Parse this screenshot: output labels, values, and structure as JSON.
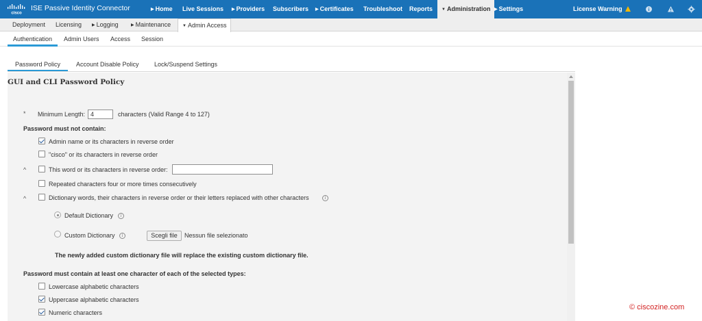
{
  "app": {
    "title": "ISE Passive Identity Connector",
    "logo_text": "cisco"
  },
  "top_nav": {
    "home": "Home",
    "live_sessions": "Live Sessions",
    "providers": "Providers",
    "subscribers": "Subscribers",
    "certificates": "Certificates",
    "troubleshoot": "Troubleshoot",
    "reports": "Reports",
    "administration": "Administration",
    "settings": "Settings",
    "license_warning": "License Warning"
  },
  "sub_nav": {
    "deployment": "Deployment",
    "licensing": "Licensing",
    "logging": "Logging",
    "maintenance": "Maintenance",
    "admin_access": "Admin Access"
  },
  "third_nav": {
    "authentication": "Authentication",
    "admin_users": "Admin Users",
    "access": "Access",
    "session": "Session"
  },
  "tabs": {
    "password_policy": "Password Policy",
    "account_disable_policy": "Account Disable Policy",
    "lock_suspend_settings": "Lock/Suspend Settings"
  },
  "policy": {
    "title": "GUI and CLI Password Policy",
    "required_mark": "*",
    "caret_mark": "^",
    "min_length_label": "Minimum Length:",
    "min_length_value": "4",
    "min_length_hint": "characters (Valid Range 4 to 127)",
    "must_not_contain_heading": "Password must not contain:",
    "opt_admin_name": "Admin name or its characters in reverse order",
    "opt_cisco": "\"cisco\" or its characters in reverse order",
    "opt_this_word": "This word or its characters in reverse order:",
    "this_word_value": "",
    "opt_repeated": "Repeated characters four or more times consecutively",
    "opt_dictionary": "Dictionary words, their characters in reverse order or their letters replaced with other characters",
    "default_dictionary": "Default Dictionary",
    "custom_dictionary": "Custom Dictionary",
    "choose_file_button": "Scegli file",
    "no_file_selected": "Nessun file selezionato",
    "custom_dictionary_note": "The newly added custom dictionary file will replace the existing custom dictionary file.",
    "must_contain_heading": "Password must contain at least one character of each of the selected types:",
    "opt_lowercase": "Lowercase alphabetic characters",
    "opt_uppercase": "Uppercase alphabetic characters",
    "opt_numeric": "Numeric characters",
    "info_glyph": "i"
  },
  "states": {
    "admin_name_checked": true,
    "cisco_checked": false,
    "this_word_checked": false,
    "repeated_checked": false,
    "dictionary_checked": false,
    "dictionary_choice": "Default Dictionary",
    "lowercase_checked": false,
    "uppercase_checked": true,
    "numeric_checked": true
  },
  "watermark": "© ciscozine.com",
  "colors": {
    "top_bar": "#1a72b8",
    "active_tab_underline": "#2a9ad6",
    "warning_icon": "#f5b800",
    "watermark": "#d22020"
  },
  "icons": {
    "logo": "cisco-logo",
    "warning": "warning-triangle-icon",
    "top_right": [
      "info-circle-icon",
      "alert-icon",
      "gear-icon"
    ],
    "field_help": "info-icon"
  }
}
